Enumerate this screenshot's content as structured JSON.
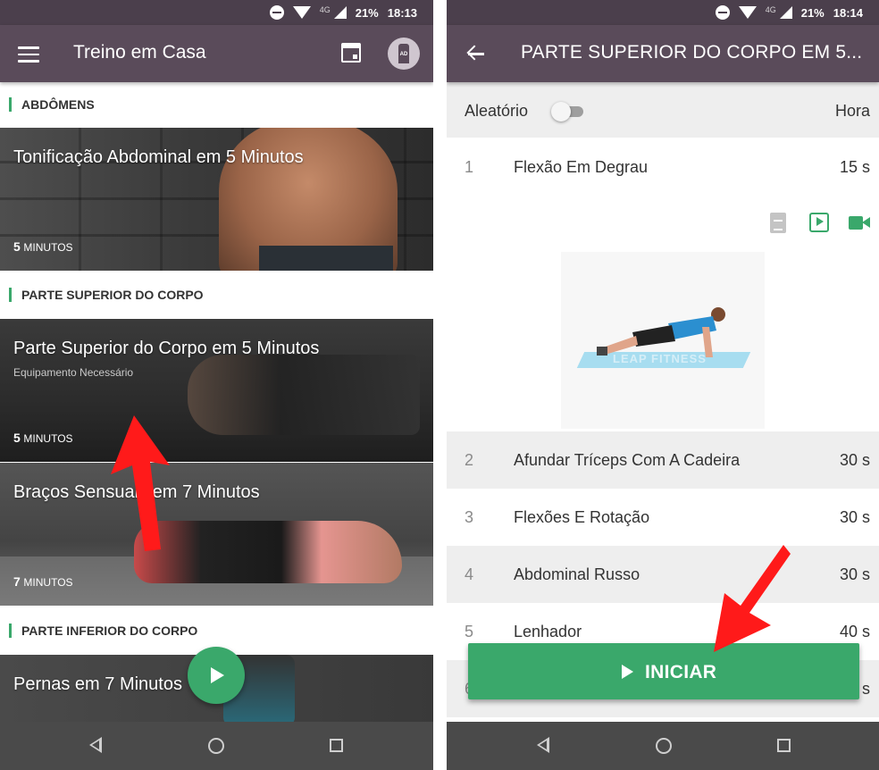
{
  "left": {
    "status": {
      "network": "4G",
      "battery": "21%",
      "time": "18:13"
    },
    "appbar": {
      "title": "Treino em Casa",
      "icons": [
        "menu-icon",
        "calendar-icon",
        "remove-ads-icon"
      ],
      "ads_badge": "AD"
    },
    "sections": [
      {
        "label": "ABDÔMENS"
      },
      {
        "label": "PARTE SUPERIOR DO CORPO"
      },
      {
        "label": "PARTE INFERIOR DO CORPO"
      }
    ],
    "cards": [
      {
        "title": "Tonificação Abdominal em 5 Minutos",
        "subtitle": "",
        "minutes": "5",
        "unit": "MINUTOS"
      },
      {
        "title": "Parte Superior do Corpo em 5 Minutos",
        "subtitle": "Equipamento Necessário",
        "minutes": "5",
        "unit": "MINUTOS"
      },
      {
        "title": "Braços Sensuais em 7 Minutos",
        "subtitle": "",
        "minutes": "7",
        "unit": "MINUTOS"
      },
      {
        "title": "Pernas em 7 Minutos",
        "subtitle": "",
        "minutes": "",
        "unit": ""
      }
    ]
  },
  "right": {
    "status": {
      "network": "4G",
      "battery": "21%",
      "time": "18:14"
    },
    "appbar": {
      "title": "PARTE SUPERIOR DO CORPO EM 5..."
    },
    "random": {
      "label": "Aleatório",
      "enabled": false,
      "time_label": "Hora"
    },
    "exercises": [
      {
        "num": "1",
        "name": "Flexão Em Degrau",
        "duration": "15 s"
      },
      {
        "num": "2",
        "name": "Afundar Tríceps Com A Cadeira",
        "duration": "30 s"
      },
      {
        "num": "3",
        "name": "Flexões E Rotação",
        "duration": "30 s"
      },
      {
        "num": "4",
        "name": "Abdominal Russo",
        "duration": "30 s"
      },
      {
        "num": "5",
        "name": "Lenhador",
        "duration": "40 s"
      },
      {
        "num": "6",
        "name": "",
        "duration": "s"
      }
    ],
    "image_watermark": "LEAP FITNESS",
    "start_button": "INICIAR"
  },
  "colors": {
    "appbar": "#5a4b5a",
    "statusbar": "#4b3f4c",
    "accent_green": "#3aa86b",
    "arrow_red": "#ff1a1a",
    "navbar": "#4a4a4a"
  }
}
